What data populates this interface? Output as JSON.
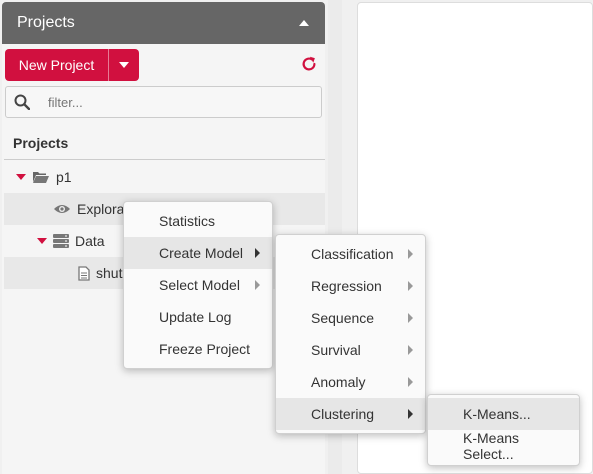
{
  "sidebar": {
    "header_title": "Projects",
    "new_project_label": "New Project",
    "filter_placeholder": "filter...",
    "section_title": "Projects",
    "tree": [
      {
        "label": "p1",
        "icon": "folder-open-icon"
      },
      {
        "label": "Explorat",
        "icon": "eye-icon"
      },
      {
        "label": "Data",
        "icon": "database-icon"
      },
      {
        "label": "shut",
        "icon": "file-icon"
      }
    ]
  },
  "colors": {
    "accent": "#d1103f",
    "header": "#666666"
  },
  "context_menu": {
    "items": [
      {
        "label": "Statistics"
      },
      {
        "label": "Create Model"
      },
      {
        "label": "Select Model"
      },
      {
        "label": "Update Log"
      },
      {
        "label": "Freeze Project"
      }
    ]
  },
  "model_menu": {
    "items": [
      {
        "label": "Classification"
      },
      {
        "label": "Regression"
      },
      {
        "label": "Sequence"
      },
      {
        "label": "Survival"
      },
      {
        "label": "Anomaly"
      },
      {
        "label": "Clustering"
      }
    ]
  },
  "clustering_menu": {
    "items": [
      {
        "label": "K-Means..."
      },
      {
        "label": "K-Means Select..."
      }
    ]
  }
}
